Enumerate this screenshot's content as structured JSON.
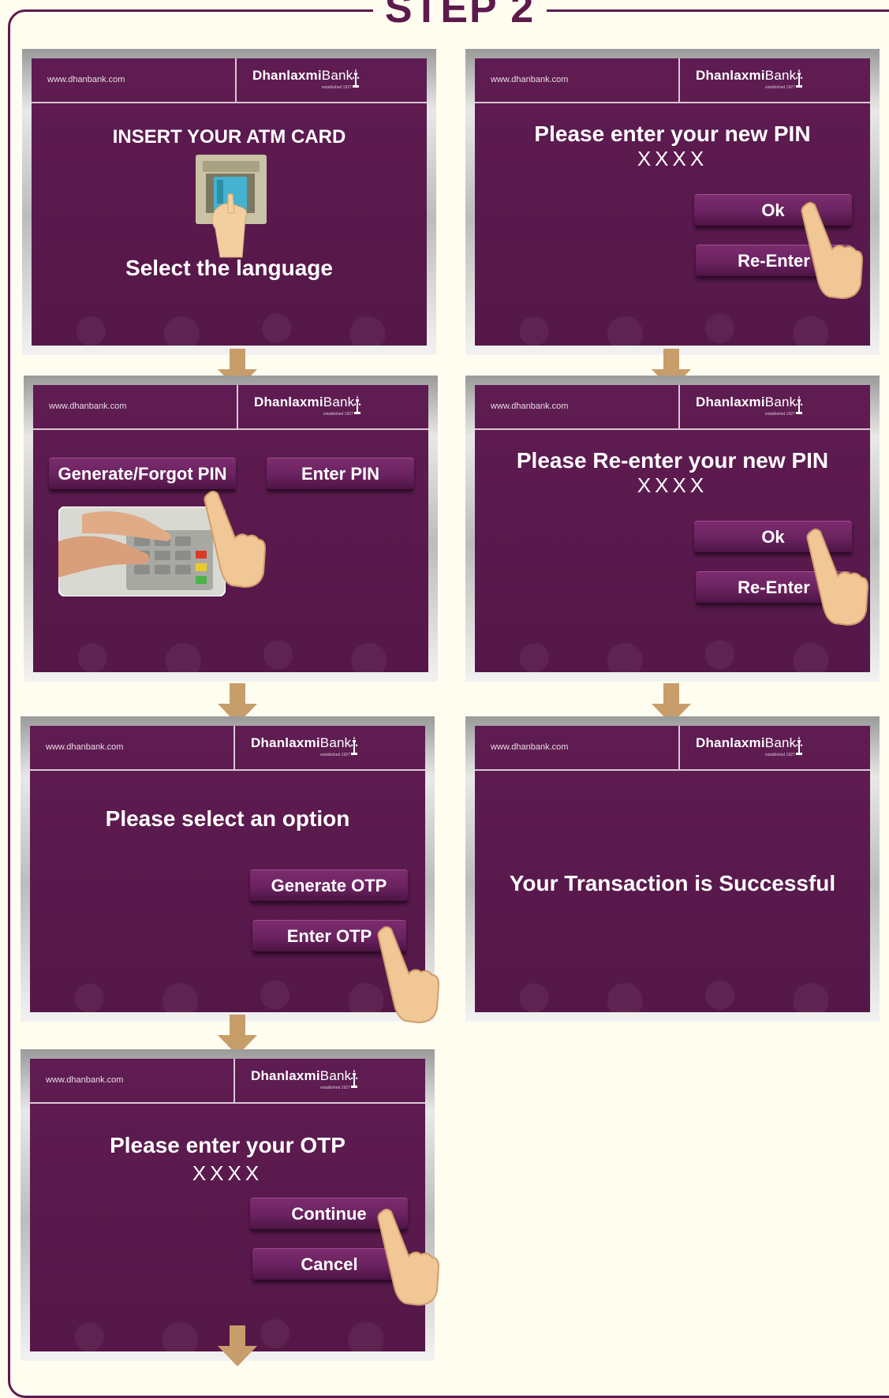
{
  "step_title": "STEP 2",
  "header": {
    "url": "www.dhanbank.com",
    "brand_bold": "Dhanlaxmi",
    "brand_light": "Bank",
    "brand_sub": "established 1927"
  },
  "screens": {
    "insert_card": {
      "title": "INSERT YOUR ATM CARD",
      "subtitle": "Select the language"
    },
    "pin_options": {
      "generate_label": "Generate/Forgot PIN",
      "enter_label": "Enter PIN"
    },
    "select_option": {
      "title": "Please select an option",
      "generate_otp_label": "Generate OTP",
      "enter_otp_label": "Enter OTP"
    },
    "enter_otp": {
      "title": "Please enter your OTP",
      "mask": "XXXX",
      "continue_label": "Continue",
      "cancel_label": "Cancel"
    },
    "new_pin": {
      "title": "Please enter your new PIN",
      "mask": "XXXX",
      "ok_label": "Ok",
      "reenter_label": "Re-Enter"
    },
    "reenter_pin": {
      "title": "Please Re-enter your new PIN",
      "mask": "XXXX",
      "ok_label": "Ok",
      "reenter_label": "Re-Enter"
    },
    "success": {
      "message": "Your Transaction is Successful"
    }
  },
  "colors": {
    "screen_bg": "#5b1a4e",
    "frame": "#5d1a4c",
    "arrow": "#c79d6a",
    "page_bg": "#fffdf0"
  }
}
